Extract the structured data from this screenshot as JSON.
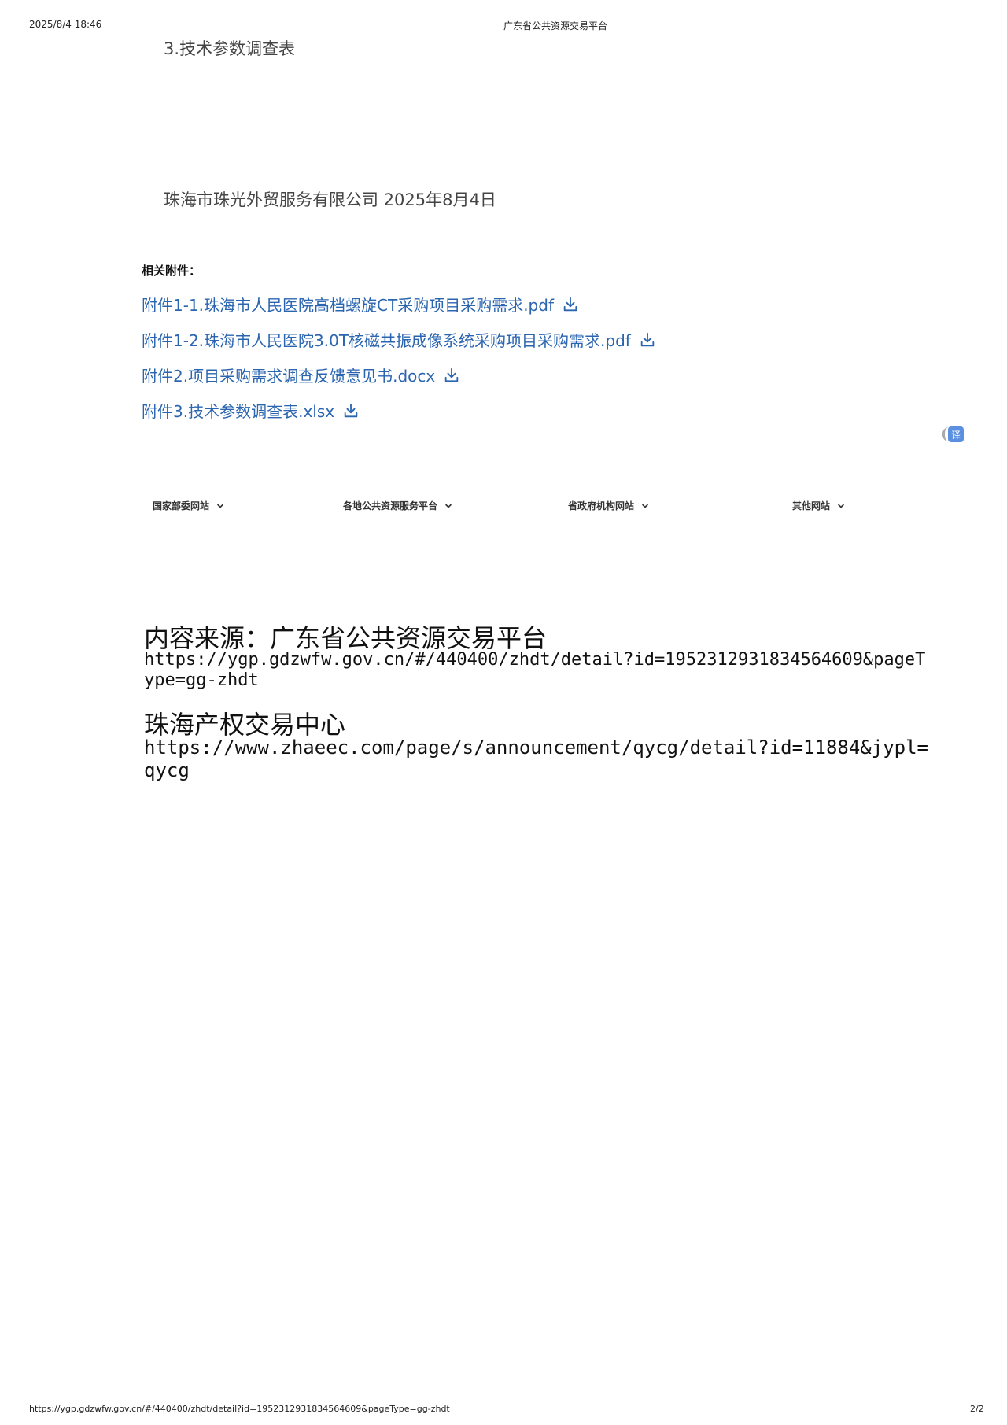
{
  "print_header": {
    "datetime": "2025/8/4 18:46",
    "title": "广东省公共资源交易平台"
  },
  "content": {
    "section_item": "3.技术参数调查表",
    "signature": "珠海市珠光外贸服务有限公司 2025年8月4日"
  },
  "attachments": {
    "title": "相关附件：",
    "items": [
      {
        "label": "附件1-1.珠海市人民医院高档螺旋CT采购项目采购需求.pdf",
        "icon": "download-icon"
      },
      {
        "label": "附件1-2.珠海市人民医院3.0T核磁共振成像系统采购项目采购需求.pdf",
        "icon": "download-icon"
      },
      {
        "label": "附件2.项目采购需求调查反馈意见书.docx",
        "icon": "download-icon"
      },
      {
        "label": "附件3.技术参数调查表.xlsx",
        "icon": "download-icon"
      }
    ]
  },
  "translate_button": {
    "label": "译"
  },
  "footer_nav": {
    "items": [
      {
        "label": "国家部委网站"
      },
      {
        "label": "各地公共资源服务平台"
      },
      {
        "label": "省政府机构网站"
      },
      {
        "label": "其他网站"
      }
    ]
  },
  "sources": [
    {
      "heading": "内容来源：广东省公共资源交易平台",
      "url": "https://ygp.gdzwfw.gov.cn/#/440400/zhdt/detail?id=1952312931834564609&pageType=gg-zhdt"
    },
    {
      "heading": "珠海产权交易中心",
      "url": "https://www.zhaeec.com/page/s/announcement/qycg/detail?id=11884&jypl=qycg"
    }
  ],
  "print_footer": {
    "url": "https://ygp.gdzwfw.gov.cn/#/440400/zhdt/detail?id=1952312931834564609&pageType=gg-zhdt",
    "page": "2/2"
  },
  "colors": {
    "link": "#2b65b0",
    "translate_badge": "#5b8fe0"
  }
}
